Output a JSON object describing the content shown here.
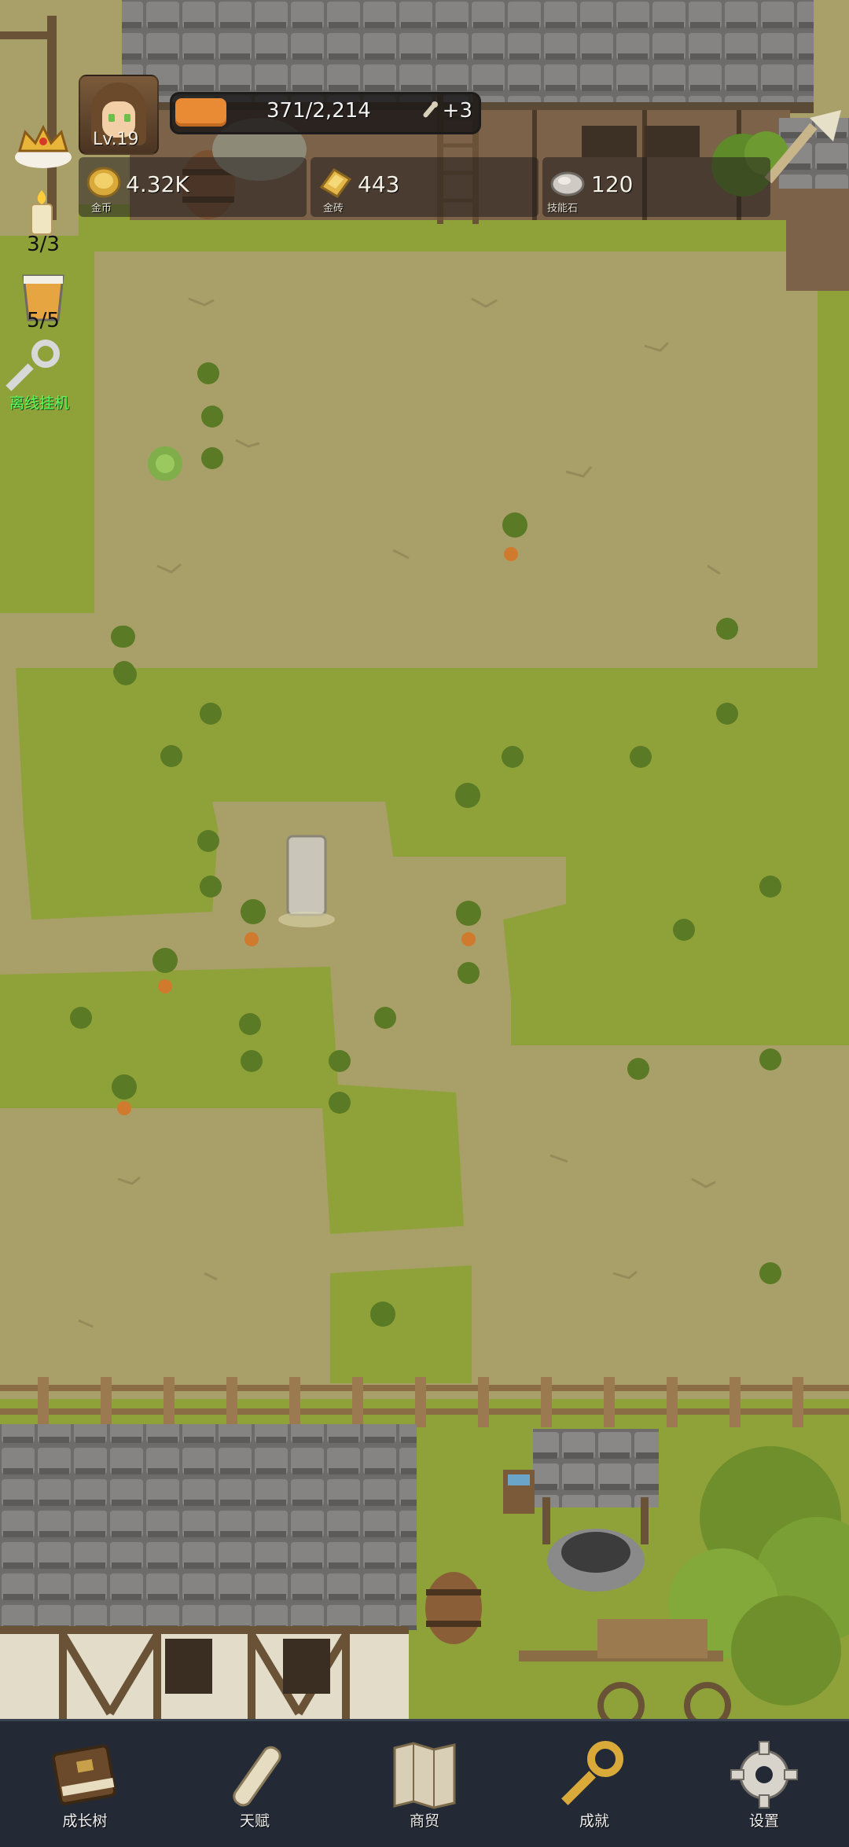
{
  "player": {
    "level": "Lv.19",
    "xp_text": "371/2,214",
    "xp_fraction": 0.17,
    "xp_bonus": "+3"
  },
  "resources": [
    {
      "value": "4.32K",
      "label": "金币",
      "icon": "gold-coin-icon"
    },
    {
      "value": "443",
      "label": "金砖",
      "icon": "gold-brick-icon"
    },
    {
      "value": "120",
      "label": "技能石",
      "icon": "skill-stone-icon"
    }
  ],
  "side": {
    "crown_icon": "crown-icon",
    "candle_count": "3/3",
    "drink_count": "5/5",
    "idle_label": "离线挂机"
  },
  "nav": [
    {
      "label": "成长树",
      "icon": "book-icon"
    },
    {
      "label": "天赋",
      "icon": "scroll-icon"
    },
    {
      "label": "商贸",
      "icon": "map-icon"
    },
    {
      "label": "成就",
      "icon": "key-icon"
    },
    {
      "label": "设置",
      "icon": "gear-icon"
    }
  ],
  "colors": {
    "dirt": "#a99f68",
    "grass": "#8fa23a",
    "nav_bg": "#232a36",
    "xp_fill": "#e88b34",
    "idle_green": "#5cff5c"
  }
}
